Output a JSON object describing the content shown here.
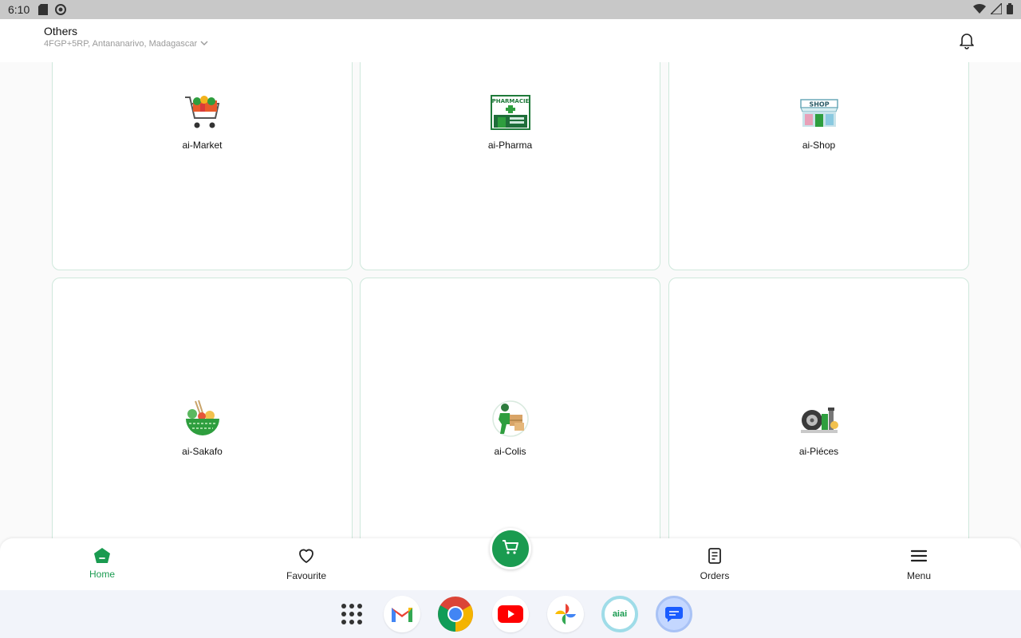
{
  "status_bar": {
    "time": "6:10"
  },
  "header": {
    "title": "Others",
    "location": "4FGP+5RP, Antananarivo, Madagascar"
  },
  "categories": [
    {
      "label": "ai-Market",
      "icon": "shopping-cart-icon"
    },
    {
      "label": "ai-Pharma",
      "icon": "pharmacy-icon"
    },
    {
      "label": "ai-Shop",
      "icon": "shop-icon"
    },
    {
      "label": "ai-Sakafo",
      "icon": "food-bowl-icon"
    },
    {
      "label": "ai-Colis",
      "icon": "delivery-courier-icon"
    },
    {
      "label": "ai-Piéces",
      "icon": "auto-parts-icon"
    }
  ],
  "bottom_nav": {
    "items": [
      {
        "label": "Home",
        "icon": "home-icon",
        "active": true
      },
      {
        "label": "Favourite",
        "icon": "heart-icon"
      },
      {
        "label": "Orders",
        "icon": "orders-icon"
      },
      {
        "label": "Menu",
        "icon": "hamburger-menu-icon"
      }
    ],
    "cart_icon": "cart-icon"
  },
  "dock": {
    "apps": [
      "app-drawer-icon",
      "gmail-icon",
      "chrome-icon",
      "youtube-icon",
      "photos-icon",
      "aiai-app-icon",
      "messages-icon"
    ],
    "aiai_text": "aiai"
  },
  "colors": {
    "accent": "#1a9b50",
    "card_border": "#cfe8dc",
    "status_bar": "#c8c8c8"
  }
}
